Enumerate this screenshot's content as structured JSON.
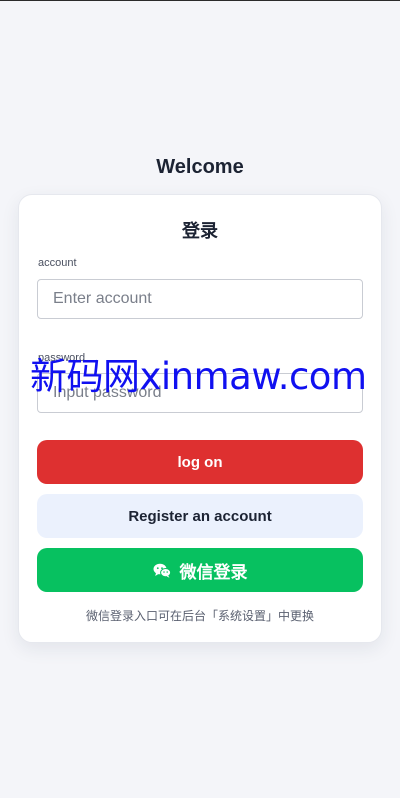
{
  "header": {
    "title": "Welcome"
  },
  "card": {
    "title": "登录",
    "account": {
      "label": "account",
      "placeholder": "Enter account"
    },
    "password": {
      "label": "password",
      "placeholder": "Input password"
    },
    "login_label": "log on",
    "register_label": "Register an account",
    "wechat_label": "微信登录",
    "hint": "微信登录入口可在后台「系统设置」中更换"
  },
  "watermark": {
    "text": "新码网xinmaw.com"
  },
  "colors": {
    "login": "#de3030",
    "register_bg": "#ebf1fd",
    "wechat": "#07c160",
    "watermark": "#1010f0"
  },
  "icons": {
    "wechat": "wechat-icon"
  }
}
